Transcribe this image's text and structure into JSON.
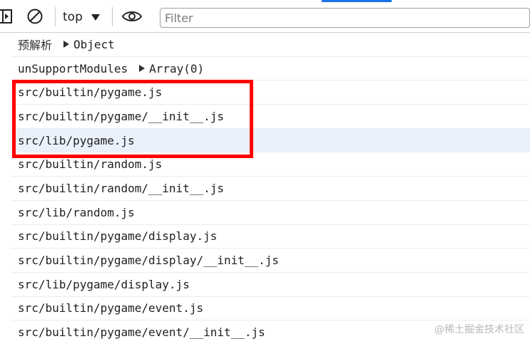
{
  "toolbar": {
    "context": "top",
    "filter_placeholder": "Filter",
    "icons": [
      "sidebar-toggle-icon",
      "clear-console-icon",
      "chevron-down-icon",
      "eye-icon"
    ]
  },
  "console": {
    "rows": [
      {
        "label": "预解析",
        "value": "Object"
      },
      {
        "label": "unSupportModules",
        "value": "Array(0)"
      },
      {
        "text": "src/builtin/pygame.js"
      },
      {
        "text": "src/builtin/pygame/__init__.js"
      },
      {
        "text": "src/lib/pygame.js"
      },
      {
        "text": "src/builtin/random.js"
      },
      {
        "text": "src/builtin/random/__init__.js"
      },
      {
        "text": "src/lib/random.js"
      },
      {
        "text": "src/builtin/pygame/display.js"
      },
      {
        "text": "src/builtin/pygame/display/__init__.js"
      },
      {
        "text": "src/lib/pygame/display.js"
      },
      {
        "text": "src/builtin/pygame/event.js"
      },
      {
        "text": "src/builtin/pygame/event/__init__.js"
      }
    ]
  },
  "annotation": {
    "color": "#ff0000"
  },
  "watermark": "@稀土掘金技术社区",
  "colors": {
    "accent": "#1a73e8",
    "highlight_row": "#eaf1fb",
    "annotation": "#ff0000"
  }
}
